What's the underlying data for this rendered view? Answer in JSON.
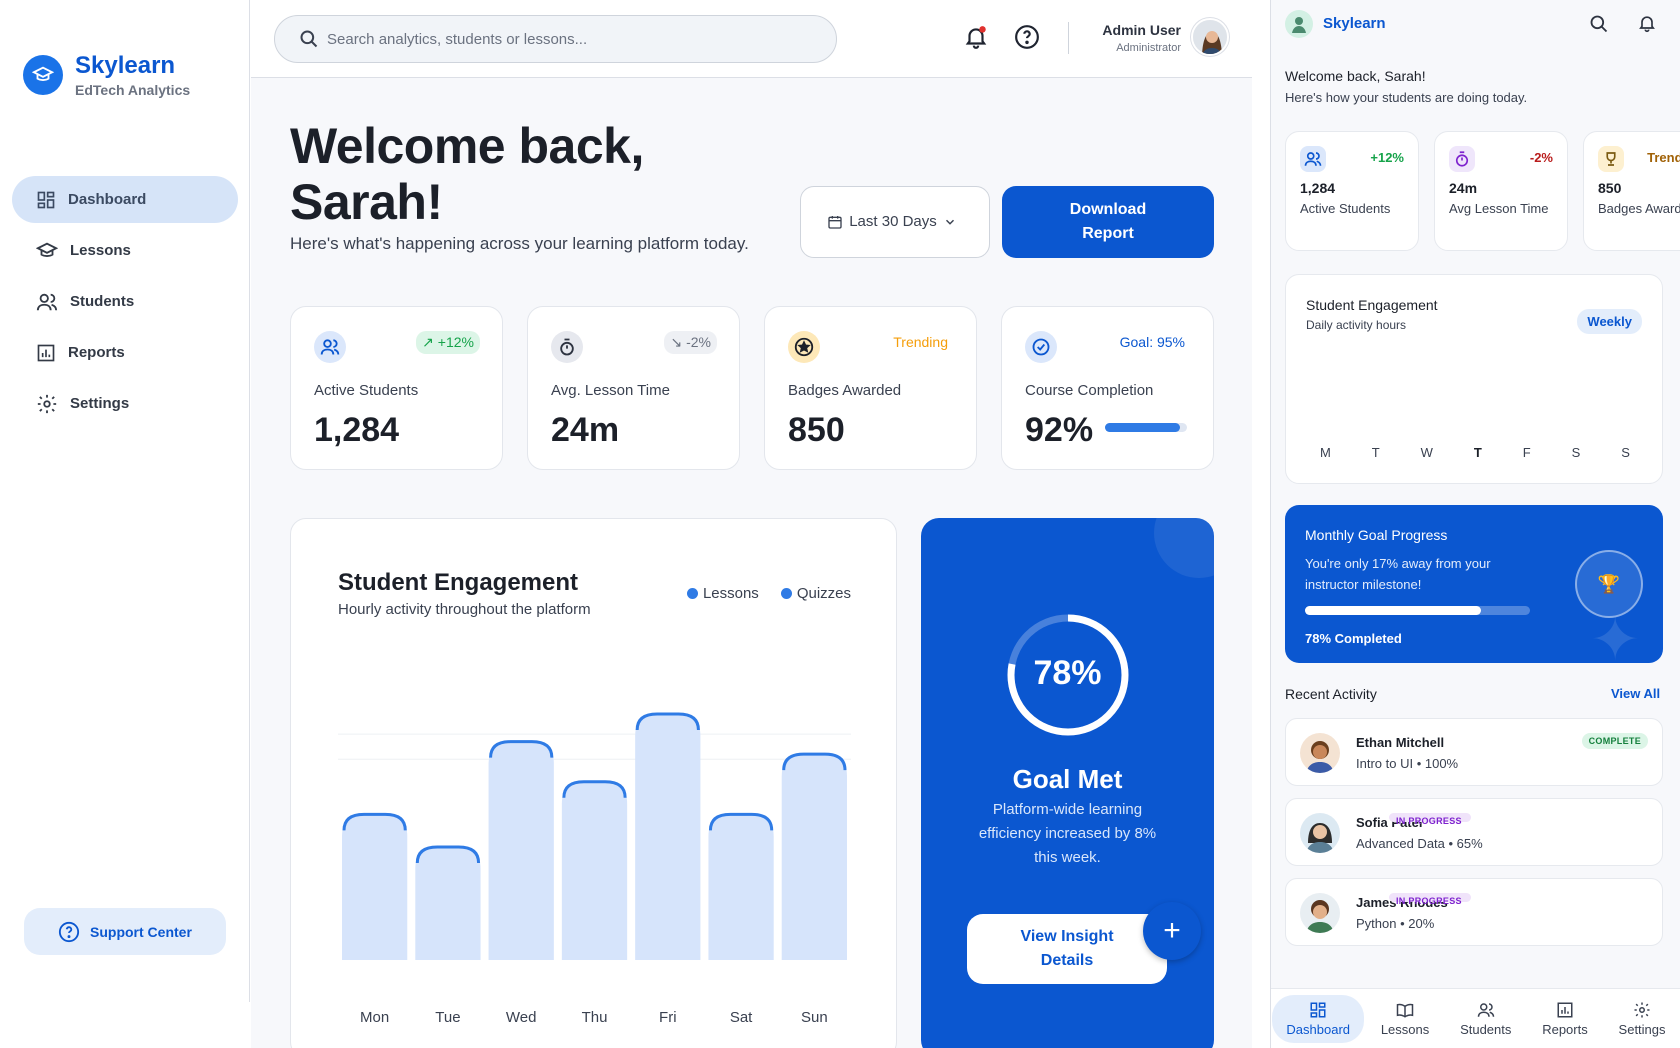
{
  "brand": {
    "name": "Skylearn",
    "subtitle": "EdTech Analytics"
  },
  "nav": [
    {
      "label": "Dashboard",
      "icon": "dashboard-icon",
      "active": true
    },
    {
      "label": "Lessons",
      "icon": "graduation-cap-icon"
    },
    {
      "label": "Students",
      "icon": "users-icon"
    },
    {
      "label": "Reports",
      "icon": "bar-chart-icon"
    },
    {
      "label": "Settings",
      "icon": "gear-icon"
    }
  ],
  "support": {
    "label": "Support Center"
  },
  "search": {
    "placeholder": "Search analytics, students or lessons..."
  },
  "user": {
    "name": "Admin User",
    "role": "Administrator"
  },
  "header": {
    "title": "Welcome back, Sarah!",
    "subtitle": "Here's what's happening across your learning platform today.",
    "range_label": "Last 30 Days",
    "download_label": "Download Report"
  },
  "stats": [
    {
      "label": "Active Students",
      "value": "1,284",
      "badge": "+12%",
      "icon": "users-icon"
    },
    {
      "label": "Avg. Lesson Time",
      "value": "24m",
      "badge": "-2%",
      "icon": "timer-icon"
    },
    {
      "label": "Badges Awarded",
      "value": "850",
      "badge": "Trending",
      "icon": "badge-icon"
    },
    {
      "label": "Course Completion",
      "value": "92%",
      "badge": "Goal: 95%",
      "icon": "check-circle-icon",
      "progress": 0.92
    }
  ],
  "chart_data": {
    "type": "bar",
    "title": "Student Engagement",
    "subtitle": "Hourly activity throughout the platform",
    "categories": [
      "Mon",
      "Tue",
      "Wed",
      "Thu",
      "Fri",
      "Sat",
      "Sun"
    ],
    "series": [
      {
        "name": "Lessons",
        "values": [
          58,
          45,
          87,
          71,
          98,
          58,
          82
        ]
      }
    ],
    "legend": [
      "Lessons",
      "Quizzes"
    ],
    "legend_position": "top-right",
    "ylim": [
      0,
      100
    ],
    "grid": true,
    "colors": {
      "bar_fill": "#d6e4fb",
      "bar_cap": "#2f7be5"
    }
  },
  "goal": {
    "percent_label": "78%",
    "percent": 0.78,
    "title": "Goal Met",
    "text": "Platform-wide learning efficiency increased by 8% this week.",
    "button": "View Insight Details",
    "fab": "+"
  },
  "panel": {
    "brand": "Skylearn",
    "welcome": "Welcome back, Sarah!",
    "welcome_sub": "Here's how your students are doing today.",
    "stats": [
      {
        "value": "1,284",
        "label": "Active Students",
        "badge": "+12%"
      },
      {
        "value": "24m",
        "label": "Avg Lesson Time",
        "badge": "-2%"
      },
      {
        "value": "850",
        "label": "Badges Awarded",
        "badge": "Trending"
      }
    ],
    "engagement": {
      "title": "Student Engagement",
      "subtitle": "Daily activity hours",
      "pill": "Weekly",
      "days": [
        "M",
        "T",
        "W",
        "T",
        "F",
        "S",
        "S"
      ]
    },
    "goal": {
      "title": "Monthly Goal Progress",
      "text": "You're only 17% away from your instructor milestone!",
      "completed": "78% Completed",
      "progress": 0.78
    },
    "recent_title": "Recent Activity",
    "view_all": "View All",
    "activity": [
      {
        "name": "Ethan Mitchell",
        "course": "Intro to UI • 100%",
        "status": "COMPLETE"
      },
      {
        "name": "Sofia Patel",
        "course": "Advanced Data • 65%",
        "status": "IN PROGRESS"
      },
      {
        "name": "James Rhodes",
        "course": "Python • 20%",
        "status": "IN PROGRESS"
      }
    ],
    "bottom_nav": [
      "Dashboard",
      "Lessons",
      "Students",
      "Reports",
      "Settings"
    ]
  },
  "colors": {
    "accent": "#0b57d0",
    "positive": "#16a34a",
    "negative": "#b91c1c",
    "trending": "#f59e0b"
  }
}
